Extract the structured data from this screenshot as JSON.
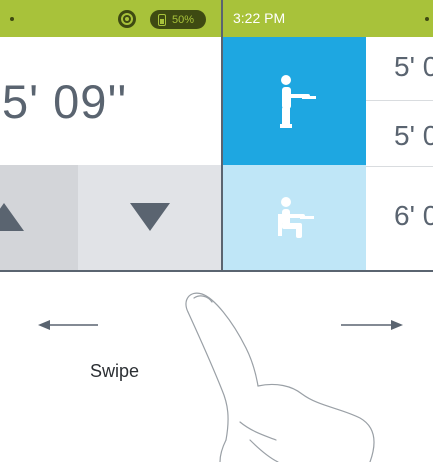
{
  "status_left": {
    "battery_percent": "50%"
  },
  "status_right": {
    "time": "3:22 PM"
  },
  "height_display": {
    "value": "5' 09''"
  },
  "presets": [
    {
      "label": "5' 0"
    },
    {
      "label": "5' 0"
    },
    {
      "label": "6' 0"
    }
  ],
  "gesture": {
    "label": "Swipe"
  },
  "colors": {
    "status_bar": "#a8c23a",
    "stand_active": "#1ea7e1",
    "sit_inactive": "#bfe6f7",
    "text": "#5a6470"
  },
  "icons": [
    "gear-icon",
    "battery-icon",
    "arrow-up-icon",
    "arrow-down-icon",
    "standing-person-icon",
    "sitting-person-icon",
    "arrow-left-icon",
    "arrow-right-icon",
    "hand-swipe-icon"
  ]
}
